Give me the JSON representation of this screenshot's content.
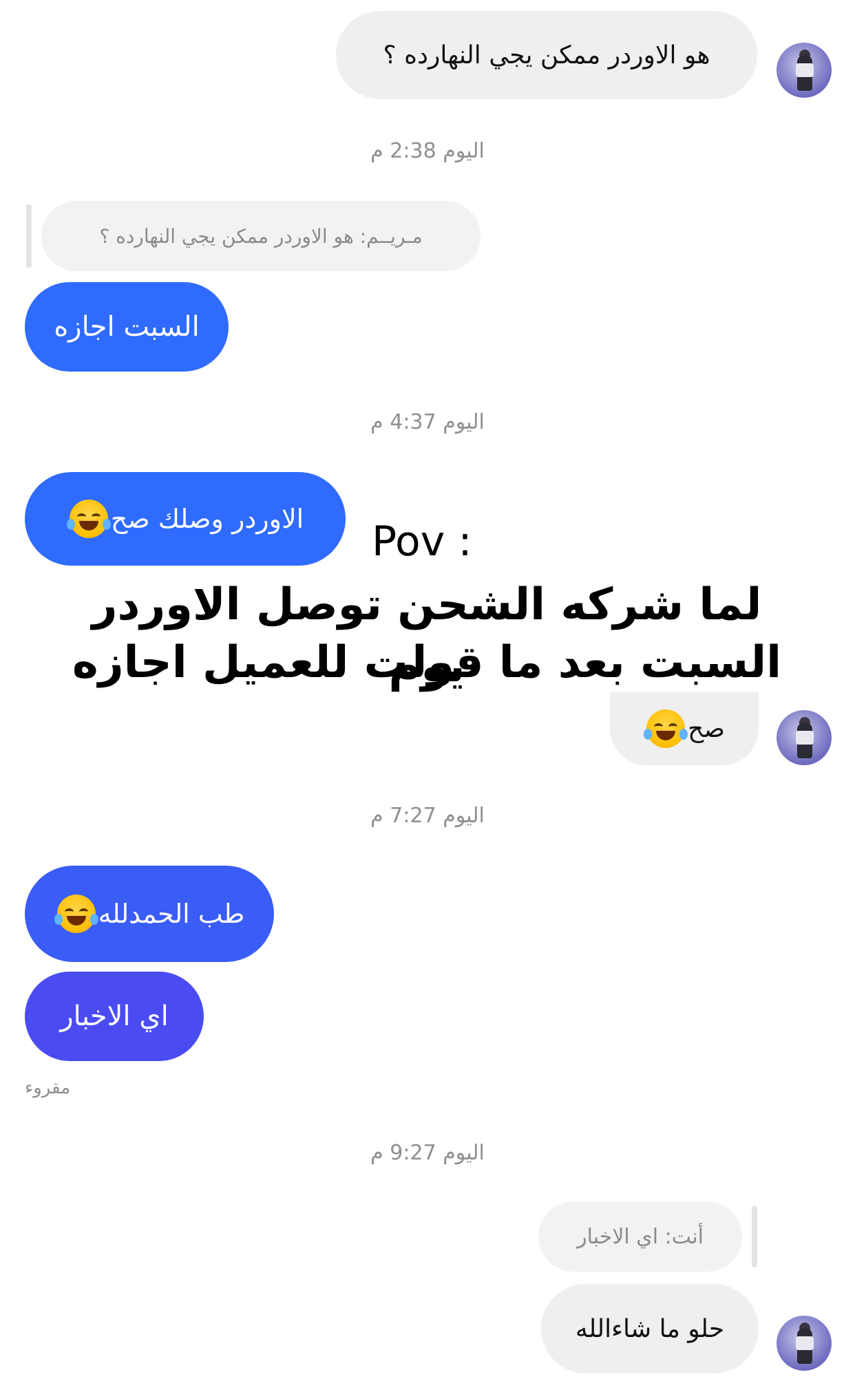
{
  "messages": {
    "m1": "هو الاوردر ممكن يجي النهارده ؟",
    "ts1": "اليوم 2:38 م",
    "reply1": "مـريــم: هو الاوردر ممكن يجي النهارده ؟",
    "m2": "السبت اجازه",
    "ts2": "اليوم 4:37 م",
    "m3": "الاوردر وصلك صح",
    "m4": "صح",
    "ts3": "اليوم 7:27 م",
    "m5": "طب الحمدلله",
    "m6": "اي الاخبار",
    "read": "مقروء",
    "ts4": "اليوم 9:27 م",
    "reply2": "أنت: اي الاخبار",
    "m7": "حلو ما شاءالله"
  },
  "overlay": {
    "pov": "Pov :",
    "caption_line1": "لما شركه الشحن توصل الاوردر يوم",
    "caption_line2": "السبت بعد ما قولت للعميل اجازه"
  },
  "icons": {
    "laugh": "face-with-tears-of-joy-icon",
    "avatar": "contact-avatar-icon"
  },
  "colors": {
    "outgoing_blue": "#2f6bff",
    "outgoing_purple": "#4a4cf2",
    "incoming_gray": "#efefef"
  }
}
